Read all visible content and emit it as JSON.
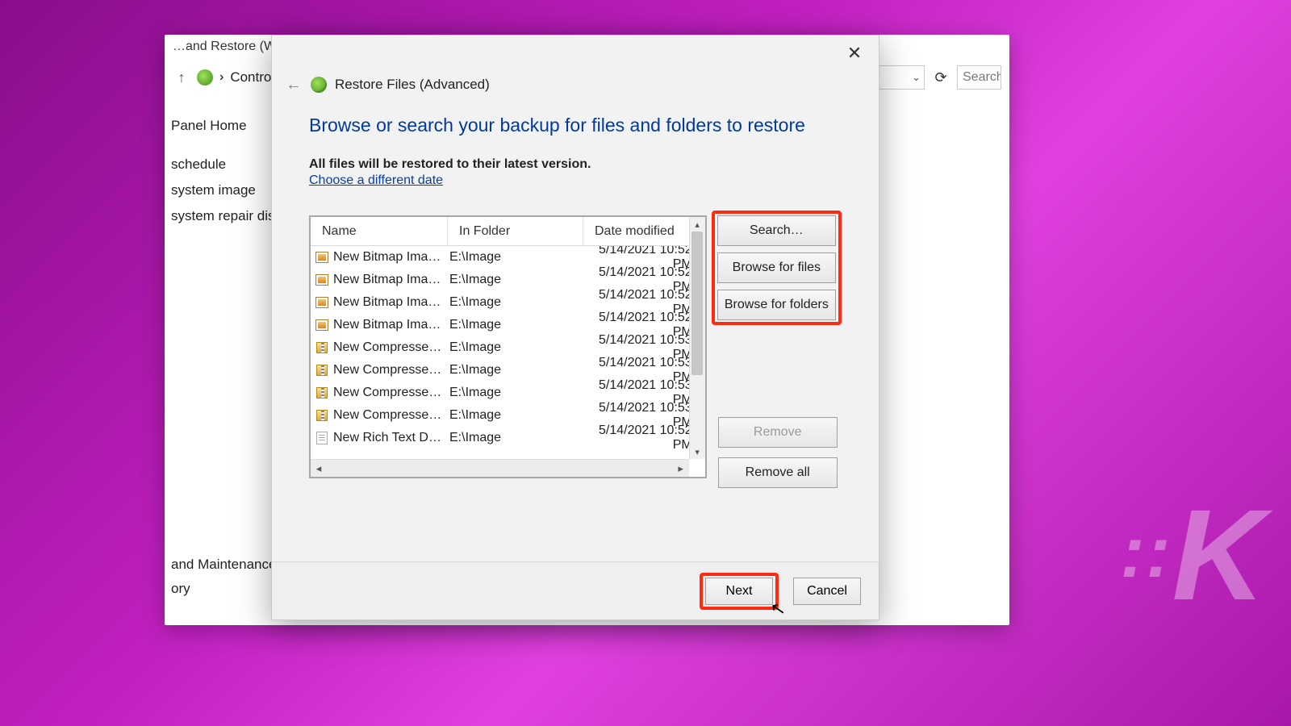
{
  "background": {
    "title": "…and Restore (Window…",
    "breadcrumb_arrow": "›",
    "breadcrumb": "Contro…",
    "search_placeholder": "Search",
    "side_home": "Panel Home",
    "side_items": [
      "schedule",
      "system image",
      "system repair disc"
    ],
    "side_lower": [
      "and Maintenance",
      "ory"
    ]
  },
  "dialog": {
    "title": "Restore Files (Advanced)",
    "heading": "Browse or search your backup for files and folders to restore",
    "note": "All files will be restored to their latest version.",
    "link": "Choose a different date",
    "columns": {
      "name": "Name",
      "folder": "In Folder",
      "date": "Date modified"
    },
    "rows": [
      {
        "icon": "bmp",
        "name": "New Bitmap Ima…",
        "folder": "E:\\Image",
        "date": "5/14/2021 10:52 PM"
      },
      {
        "icon": "bmp",
        "name": "New Bitmap Ima…",
        "folder": "E:\\Image",
        "date": "5/14/2021 10:52 PM"
      },
      {
        "icon": "bmp",
        "name": "New Bitmap Ima…",
        "folder": "E:\\Image",
        "date": "5/14/2021 10:52 PM"
      },
      {
        "icon": "bmp",
        "name": "New Bitmap Ima…",
        "folder": "E:\\Image",
        "date": "5/14/2021 10:52 PM"
      },
      {
        "icon": "zip",
        "name": "New Compresse…",
        "folder": "E:\\Image",
        "date": "5/14/2021 10:53 PM"
      },
      {
        "icon": "zip",
        "name": "New Compresse…",
        "folder": "E:\\Image",
        "date": "5/14/2021 10:53 PM"
      },
      {
        "icon": "zip",
        "name": "New Compresse…",
        "folder": "E:\\Image",
        "date": "5/14/2021 10:53 PM"
      },
      {
        "icon": "zip",
        "name": "New Compresse…",
        "folder": "E:\\Image",
        "date": "5/14/2021 10:53 PM"
      },
      {
        "icon": "rtf",
        "name": "New Rich Text D…",
        "folder": "E:\\Image",
        "date": "5/14/2021 10:52 PM"
      }
    ],
    "buttons": {
      "search": "Search…",
      "browse_files": "Browse for files",
      "browse_folders": "Browse for folders",
      "remove": "Remove",
      "remove_all": "Remove all",
      "next": "Next",
      "cancel": "Cancel"
    }
  }
}
